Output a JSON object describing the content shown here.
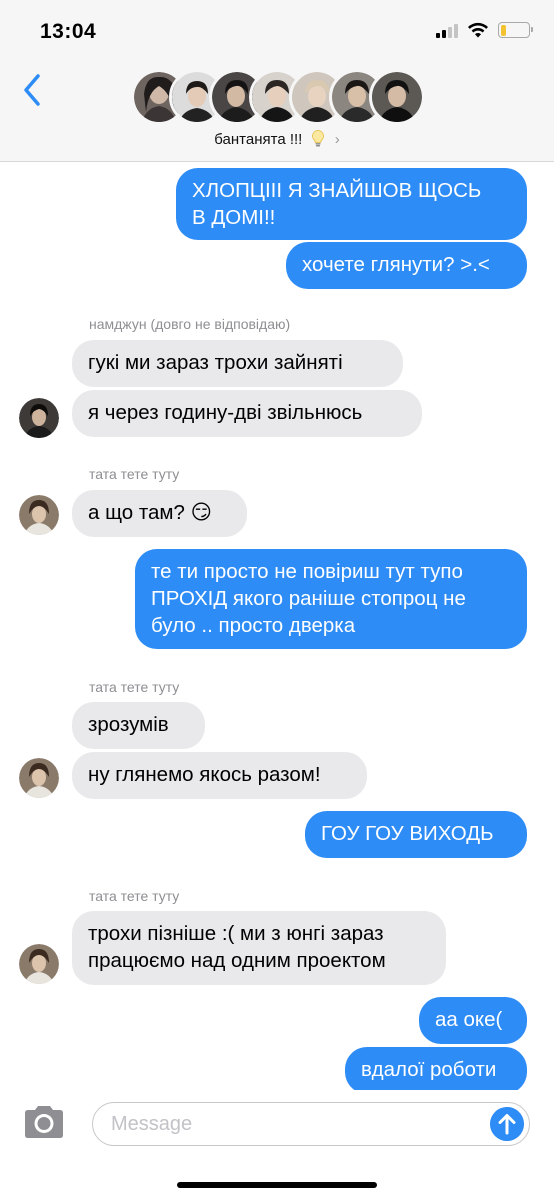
{
  "status_bar": {
    "time": "13:04",
    "icons": [
      "signal-icon",
      "wifi-icon",
      "battery-icon"
    ],
    "battery_level": 0.2
  },
  "header": {
    "back_icon": "chevron-left-icon",
    "group_name": "бантанята !!!",
    "group_name_icon": "lightbulb-icon",
    "details_icon": "chevron-right-icon",
    "participant_count": 7
  },
  "messages": [
    {
      "direction": "out",
      "text": "ХЛОПЦІІІ Я ЗНАЙШОВ ЩОСЬ\nВ ДОМІ!!"
    },
    {
      "direction": "out",
      "text": "хочете глянути? >.<"
    },
    {
      "sender": "намджун (довго не відповідаю)"
    },
    {
      "direction": "in",
      "text": "гукі ми зараз трохи зайняті"
    },
    {
      "direction": "in",
      "text": "я через годину-дві звільнюсь"
    },
    {
      "sender": "тата тете туту"
    },
    {
      "direction": "in",
      "text": "а що там? 😏"
    },
    {
      "direction": "out",
      "text": "те ти просто не повіриш тут тупо\nПРОХІД якого раніше стопроц не\nбуло .. просто дверка"
    },
    {
      "sender": "тата тете туту"
    },
    {
      "direction": "in",
      "text": "зрозумів"
    },
    {
      "direction": "in",
      "text": "ну глянемо якось разом!"
    },
    {
      "direction": "out",
      "text": "ГОУ ГОУ ВИХОДЬ"
    },
    {
      "sender": "тата тете туту"
    },
    {
      "direction": "in",
      "text": "трохи пізніше :( ми з юнгі зараз\nпрацюємо над одним проектом"
    },
    {
      "direction": "out",
      "text": "аа оке("
    },
    {
      "direction": "out",
      "text": "вдалої роботи"
    }
  ],
  "input_bar": {
    "camera_icon": "camera-icon",
    "placeholder": "Message",
    "value": "",
    "send_icon": "arrow-up-icon"
  },
  "colors": {
    "outgoing_bubble": "#2d8cf6",
    "incoming_bubble": "#e9e9eb",
    "header_background": "#f6f6f6",
    "accent": "#2d8cf6"
  }
}
